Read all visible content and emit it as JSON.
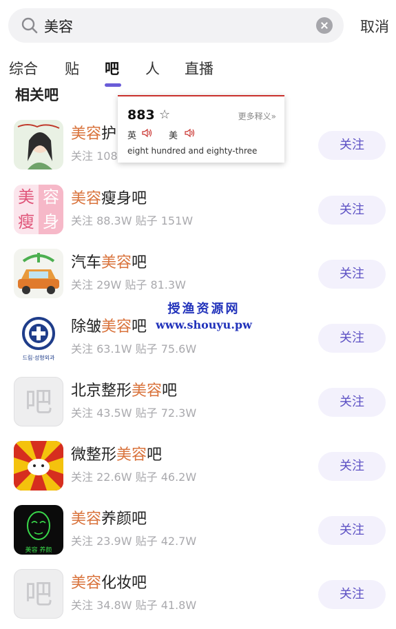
{
  "search": {
    "query": "美容",
    "cancel_label": "取消"
  },
  "tabs": [
    {
      "label": "综合"
    },
    {
      "label": "贴"
    },
    {
      "label": "吧"
    },
    {
      "label": "人"
    },
    {
      "label": "直播"
    }
  ],
  "active_tab": "吧",
  "section_heading": "相关吧",
  "bars": [
    {
      "name_pre": "",
      "name_hl": "美容",
      "name_post": "护",
      "stats": "关注 108",
      "follow_label": "关注",
      "icon": "portrait-illustration"
    },
    {
      "name_pre": "",
      "name_hl": "美容",
      "name_post": "瘦身吧",
      "stats": "关注 88.3W 贴子 151W",
      "follow_label": "关注",
      "icon": "pink-text-tile"
    },
    {
      "name_pre": "汽车",
      "name_hl": "美容",
      "name_post": "吧",
      "stats": "关注 29W 贴子 81.3W",
      "follow_label": "关注",
      "icon": "car-wash"
    },
    {
      "name_pre": "除皱",
      "name_hl": "美容",
      "name_post": "吧",
      "stats": "关注 63.1W 贴子 75.6W",
      "follow_label": "关注",
      "icon": "clinic-logo"
    },
    {
      "name_pre": "北京整形",
      "name_hl": "美容",
      "name_post": "吧",
      "stats": "关注 43.5W 贴子 72.3W",
      "follow_label": "关注",
      "icon": "bar-placeholder"
    },
    {
      "name_pre": "微整形",
      "name_hl": "美容",
      "name_post": "吧",
      "stats": "关注 22.6W 贴子 46.2W",
      "follow_label": "关注",
      "icon": "sunburst-mascot"
    },
    {
      "name_pre": "",
      "name_hl": "美容",
      "name_post": "养颜吧",
      "stats": "关注 23.9W 贴子 42.7W",
      "follow_label": "关注",
      "icon": "neon-face"
    },
    {
      "name_pre": "",
      "name_hl": "美容",
      "name_post": "化妆吧",
      "stats": "关注 34.8W 贴子 41.8W",
      "follow_label": "关注",
      "icon": "bar-placeholder"
    }
  ],
  "icon_text": {
    "placeholder": "吧",
    "pink_tile": [
      "美",
      "容",
      "瘦",
      "身"
    ],
    "clinic_logo_bottom": "드림·성형외과",
    "neon_face_bottom": "美容  养颜"
  },
  "popup": {
    "word": "883",
    "more": "更多释义»",
    "uk_label": "英",
    "us_label": "美",
    "definition": "eight hundred and eighty-three"
  },
  "watermark": {
    "line1": "授渔资源网",
    "line2": "www.shouyu.pw"
  },
  "colors": {
    "accent": "#6a5cd8",
    "highlight": "#d9733c",
    "follow_bg": "#f3f1fc",
    "popup_border": "#c9302c",
    "watermark": "#2233bb"
  }
}
